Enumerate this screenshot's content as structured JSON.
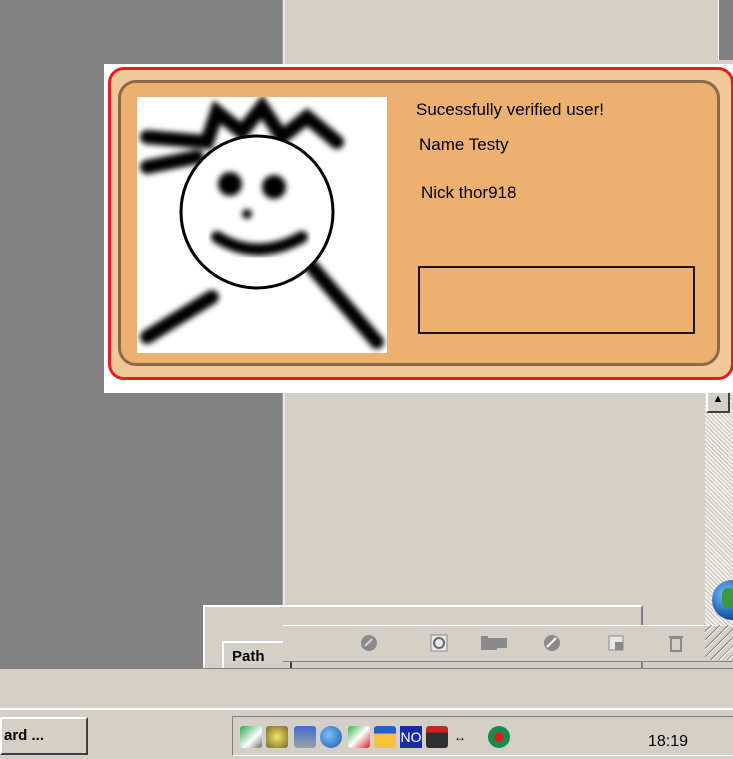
{
  "popup": {
    "status": "Sucessfully verified user!",
    "name_line": "Name Testy",
    "nick_line": "Nick thor918",
    "extra_box_value": ""
  },
  "panel": {
    "tab_label": "Path",
    "toolbar_icons": [
      "fill-path-icon",
      "stroke-path-icon",
      "load-selection-icon",
      "make-work-path-icon",
      "new-path-icon",
      "delete-path-icon"
    ]
  },
  "taskbar": {
    "task_button_label": "ard ...",
    "clock": "18:19",
    "tray_icons": [
      "network-icon",
      "volume-icon",
      "computer-icon",
      "globe-icon",
      "tool-icon",
      "window-icon",
      "no-icon",
      "film-icon",
      "arrows-icon",
      "security-icon"
    ],
    "tray_no_label": "NO"
  },
  "colors": {
    "popup_border": "#e02020",
    "card_fill": "#ecb070",
    "card_outer": "#f0c89a"
  }
}
